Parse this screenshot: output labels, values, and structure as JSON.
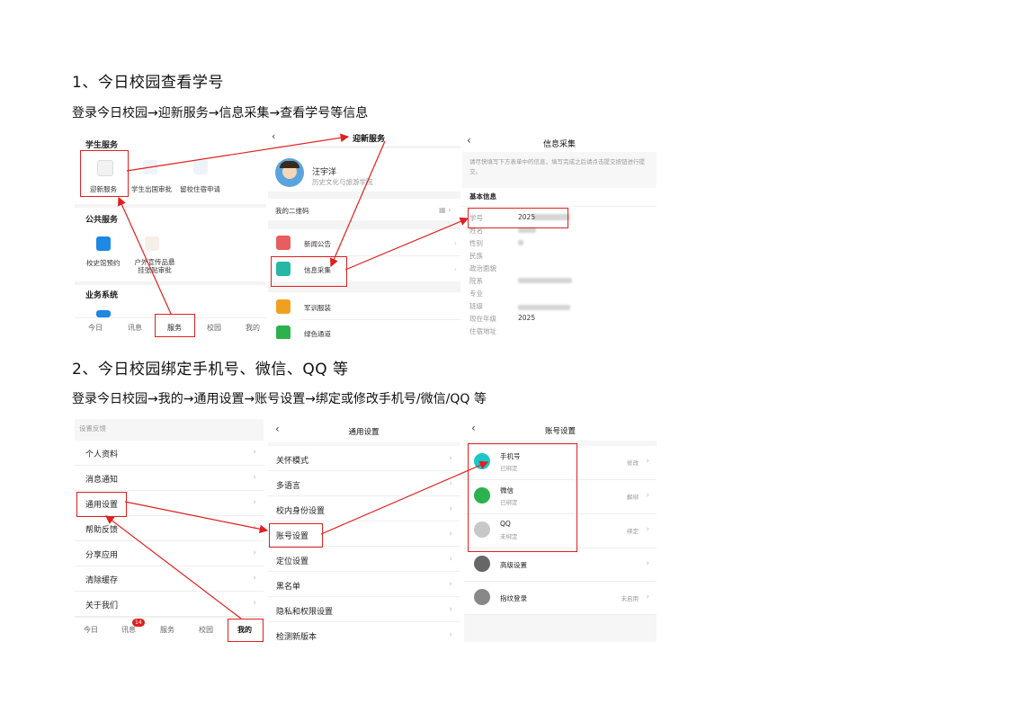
{
  "section1": {
    "heading": "1、今日校园查看学号",
    "path": "登录今日校园→迎新服务→信息采集→查看学号等信息",
    "shot1": {
      "student_services": "学生服务",
      "items": [
        "迎新服务",
        "学生出国审批",
        "留校住宿申请"
      ],
      "public_services": "公共服务",
      "public_items": [
        "校史馆预约",
        "户外宣传品悬挂张贴审批"
      ],
      "business": "业务系统",
      "tabs": [
        "今日",
        "讯息",
        "服务",
        "校园",
        "我的"
      ]
    },
    "shot2": {
      "title": "迎新服务",
      "user_name": "汪宇洋",
      "user_college": "历史文化与旅游学院",
      "qr": "我的二维码",
      "rows": [
        "新闻公告",
        "信息采集",
        "军训服装",
        "绿色通道"
      ]
    },
    "shot3": {
      "title": "信息采集",
      "notice": "请尽快填写下方表单中的信息，填写完成之后请点击提交按钮进行提交。",
      "basic": "基本信息",
      "fields": [
        "学号",
        "姓名",
        "性别",
        "民族",
        "政治面貌",
        "院系",
        "专业",
        "班级",
        "现在年级",
        "住宿地址"
      ],
      "values": [
        "2025",
        "",
        "",
        "",
        "",
        "",
        "",
        "",
        "2025",
        ""
      ]
    }
  },
  "section2": {
    "heading": "2、今日校园绑定手机号、微信、QQ 等",
    "path": "登录今日校园→我的→通用设置→账号设置→绑定或修改手机号/微信/QQ 等",
    "shot1": {
      "header": "设置反馈",
      "rows": [
        "个人资料",
        "消息通知",
        "通用设置",
        "帮助反馈",
        "分享应用",
        "清除缓存",
        "关于我们"
      ],
      "tabs": [
        "今日",
        "讯息",
        "服务",
        "校园",
        "我的"
      ],
      "badge": "14"
    },
    "shot2": {
      "title": "通用设置",
      "rows": [
        "关怀模式",
        "多语言",
        "校内身份设置",
        "账号设置",
        "定位设置",
        "黑名单",
        "隐私和权限设置",
        "检测新版本"
      ]
    },
    "shot3": {
      "title": "账号设置",
      "items": [
        {
          "name": "手机号",
          "sub": "已绑定",
          "action": "修改"
        },
        {
          "name": "微信",
          "sub": "已绑定",
          "action": "解绑"
        },
        {
          "name": "QQ",
          "sub": "未绑定",
          "action": "绑定"
        },
        {
          "name": "高级设置",
          "sub": "",
          "action": ""
        },
        {
          "name": "指纹登录",
          "sub": "",
          "action": "未启用"
        }
      ]
    }
  },
  "colors": {
    "accent_red": "#e02020",
    "teal": "#1cc7c7",
    "green": "#2bb24c"
  }
}
